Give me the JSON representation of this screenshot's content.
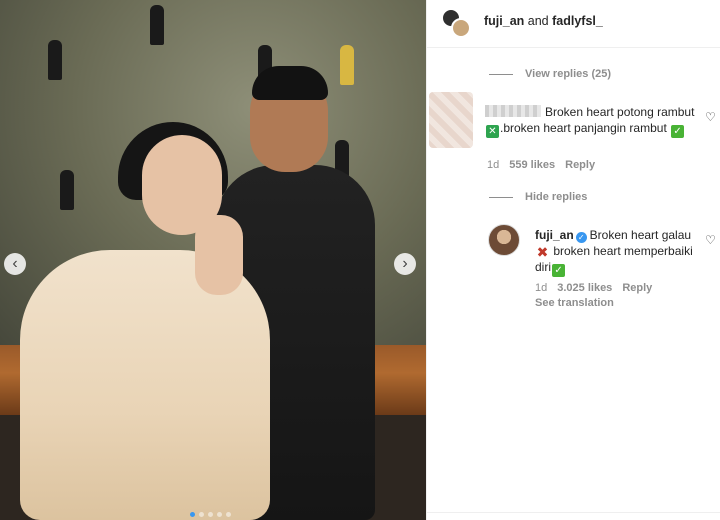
{
  "header": {
    "user1": "fuji_an",
    "and": "and",
    "user2": "fadlyfsl_"
  },
  "thread": {
    "view_replies": "View replies (25)",
    "comment": {
      "text_1": "Broken heart potong rambut",
      "text_2": ".broken heart panjangin rambut",
      "age": "1d",
      "likes": "559 likes",
      "reply": "Reply"
    },
    "hide_replies": "Hide replies",
    "reply": {
      "username": "fuji_an",
      "text_1": "Broken heart galau",
      "text_2": " broken heart memperbaiki diri",
      "age": "1d",
      "likes": "3.025 likes",
      "reply": "Reply",
      "see_translation": "See translation"
    }
  },
  "icons": {
    "heart": "heart-outline-icon",
    "verified": "verified-badge-icon",
    "prev": "chevron-left-icon",
    "next": "chevron-right-icon"
  },
  "colors": {
    "accent": "#3897f0",
    "secondary_text": "#8e8e8e",
    "check_green": "#49b335",
    "cross_red": "#c0392b"
  },
  "carousel": {
    "slide_count": 5,
    "active_slide": 1
  }
}
